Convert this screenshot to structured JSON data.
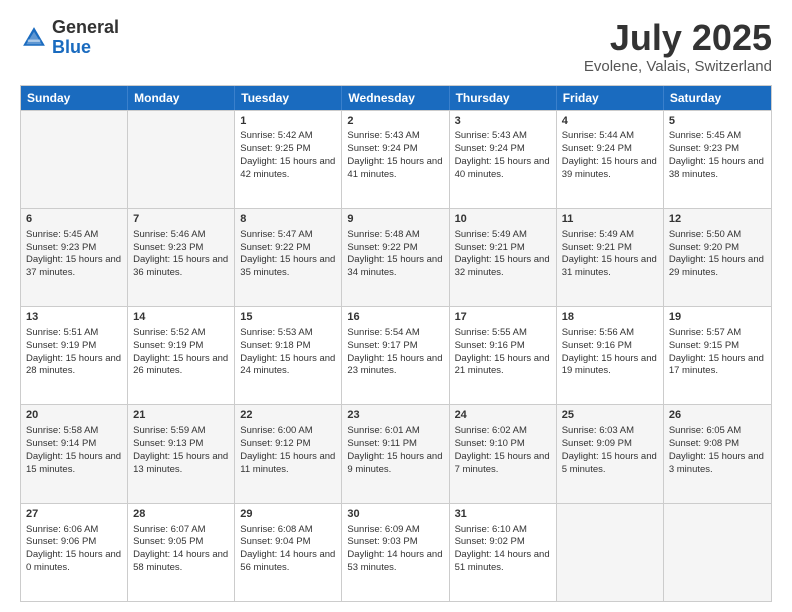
{
  "logo": {
    "general": "General",
    "blue": "Blue"
  },
  "title": "July 2025",
  "subtitle": "Evolene, Valais, Switzerland",
  "days_header": [
    "Sunday",
    "Monday",
    "Tuesday",
    "Wednesday",
    "Thursday",
    "Friday",
    "Saturday"
  ],
  "weeks": [
    [
      {
        "day": "",
        "empty": true
      },
      {
        "day": "",
        "empty": true
      },
      {
        "day": "1",
        "sunrise": "Sunrise: 5:42 AM",
        "sunset": "Sunset: 9:25 PM",
        "daylight": "Daylight: 15 hours and 42 minutes."
      },
      {
        "day": "2",
        "sunrise": "Sunrise: 5:43 AM",
        "sunset": "Sunset: 9:24 PM",
        "daylight": "Daylight: 15 hours and 41 minutes."
      },
      {
        "day": "3",
        "sunrise": "Sunrise: 5:43 AM",
        "sunset": "Sunset: 9:24 PM",
        "daylight": "Daylight: 15 hours and 40 minutes."
      },
      {
        "day": "4",
        "sunrise": "Sunrise: 5:44 AM",
        "sunset": "Sunset: 9:24 PM",
        "daylight": "Daylight: 15 hours and 39 minutes."
      },
      {
        "day": "5",
        "sunrise": "Sunrise: 5:45 AM",
        "sunset": "Sunset: 9:23 PM",
        "daylight": "Daylight: 15 hours and 38 minutes."
      }
    ],
    [
      {
        "day": "6",
        "sunrise": "Sunrise: 5:45 AM",
        "sunset": "Sunset: 9:23 PM",
        "daylight": "Daylight: 15 hours and 37 minutes."
      },
      {
        "day": "7",
        "sunrise": "Sunrise: 5:46 AM",
        "sunset": "Sunset: 9:23 PM",
        "daylight": "Daylight: 15 hours and 36 minutes."
      },
      {
        "day": "8",
        "sunrise": "Sunrise: 5:47 AM",
        "sunset": "Sunset: 9:22 PM",
        "daylight": "Daylight: 15 hours and 35 minutes."
      },
      {
        "day": "9",
        "sunrise": "Sunrise: 5:48 AM",
        "sunset": "Sunset: 9:22 PM",
        "daylight": "Daylight: 15 hours and 34 minutes."
      },
      {
        "day": "10",
        "sunrise": "Sunrise: 5:49 AM",
        "sunset": "Sunset: 9:21 PM",
        "daylight": "Daylight: 15 hours and 32 minutes."
      },
      {
        "day": "11",
        "sunrise": "Sunrise: 5:49 AM",
        "sunset": "Sunset: 9:21 PM",
        "daylight": "Daylight: 15 hours and 31 minutes."
      },
      {
        "day": "12",
        "sunrise": "Sunrise: 5:50 AM",
        "sunset": "Sunset: 9:20 PM",
        "daylight": "Daylight: 15 hours and 29 minutes."
      }
    ],
    [
      {
        "day": "13",
        "sunrise": "Sunrise: 5:51 AM",
        "sunset": "Sunset: 9:19 PM",
        "daylight": "Daylight: 15 hours and 28 minutes."
      },
      {
        "day": "14",
        "sunrise": "Sunrise: 5:52 AM",
        "sunset": "Sunset: 9:19 PM",
        "daylight": "Daylight: 15 hours and 26 minutes."
      },
      {
        "day": "15",
        "sunrise": "Sunrise: 5:53 AM",
        "sunset": "Sunset: 9:18 PM",
        "daylight": "Daylight: 15 hours and 24 minutes."
      },
      {
        "day": "16",
        "sunrise": "Sunrise: 5:54 AM",
        "sunset": "Sunset: 9:17 PM",
        "daylight": "Daylight: 15 hours and 23 minutes."
      },
      {
        "day": "17",
        "sunrise": "Sunrise: 5:55 AM",
        "sunset": "Sunset: 9:16 PM",
        "daylight": "Daylight: 15 hours and 21 minutes."
      },
      {
        "day": "18",
        "sunrise": "Sunrise: 5:56 AM",
        "sunset": "Sunset: 9:16 PM",
        "daylight": "Daylight: 15 hours and 19 minutes."
      },
      {
        "day": "19",
        "sunrise": "Sunrise: 5:57 AM",
        "sunset": "Sunset: 9:15 PM",
        "daylight": "Daylight: 15 hours and 17 minutes."
      }
    ],
    [
      {
        "day": "20",
        "sunrise": "Sunrise: 5:58 AM",
        "sunset": "Sunset: 9:14 PM",
        "daylight": "Daylight: 15 hours and 15 minutes."
      },
      {
        "day": "21",
        "sunrise": "Sunrise: 5:59 AM",
        "sunset": "Sunset: 9:13 PM",
        "daylight": "Daylight: 15 hours and 13 minutes."
      },
      {
        "day": "22",
        "sunrise": "Sunrise: 6:00 AM",
        "sunset": "Sunset: 9:12 PM",
        "daylight": "Daylight: 15 hours and 11 minutes."
      },
      {
        "day": "23",
        "sunrise": "Sunrise: 6:01 AM",
        "sunset": "Sunset: 9:11 PM",
        "daylight": "Daylight: 15 hours and 9 minutes."
      },
      {
        "day": "24",
        "sunrise": "Sunrise: 6:02 AM",
        "sunset": "Sunset: 9:10 PM",
        "daylight": "Daylight: 15 hours and 7 minutes."
      },
      {
        "day": "25",
        "sunrise": "Sunrise: 6:03 AM",
        "sunset": "Sunset: 9:09 PM",
        "daylight": "Daylight: 15 hours and 5 minutes."
      },
      {
        "day": "26",
        "sunrise": "Sunrise: 6:05 AM",
        "sunset": "Sunset: 9:08 PM",
        "daylight": "Daylight: 15 hours and 3 minutes."
      }
    ],
    [
      {
        "day": "27",
        "sunrise": "Sunrise: 6:06 AM",
        "sunset": "Sunset: 9:06 PM",
        "daylight": "Daylight: 15 hours and 0 minutes."
      },
      {
        "day": "28",
        "sunrise": "Sunrise: 6:07 AM",
        "sunset": "Sunset: 9:05 PM",
        "daylight": "Daylight: 14 hours and 58 minutes."
      },
      {
        "day": "29",
        "sunrise": "Sunrise: 6:08 AM",
        "sunset": "Sunset: 9:04 PM",
        "daylight": "Daylight: 14 hours and 56 minutes."
      },
      {
        "day": "30",
        "sunrise": "Sunrise: 6:09 AM",
        "sunset": "Sunset: 9:03 PM",
        "daylight": "Daylight: 14 hours and 53 minutes."
      },
      {
        "day": "31",
        "sunrise": "Sunrise: 6:10 AM",
        "sunset": "Sunset: 9:02 PM",
        "daylight": "Daylight: 14 hours and 51 minutes."
      },
      {
        "day": "",
        "empty": true
      },
      {
        "day": "",
        "empty": true
      }
    ]
  ]
}
